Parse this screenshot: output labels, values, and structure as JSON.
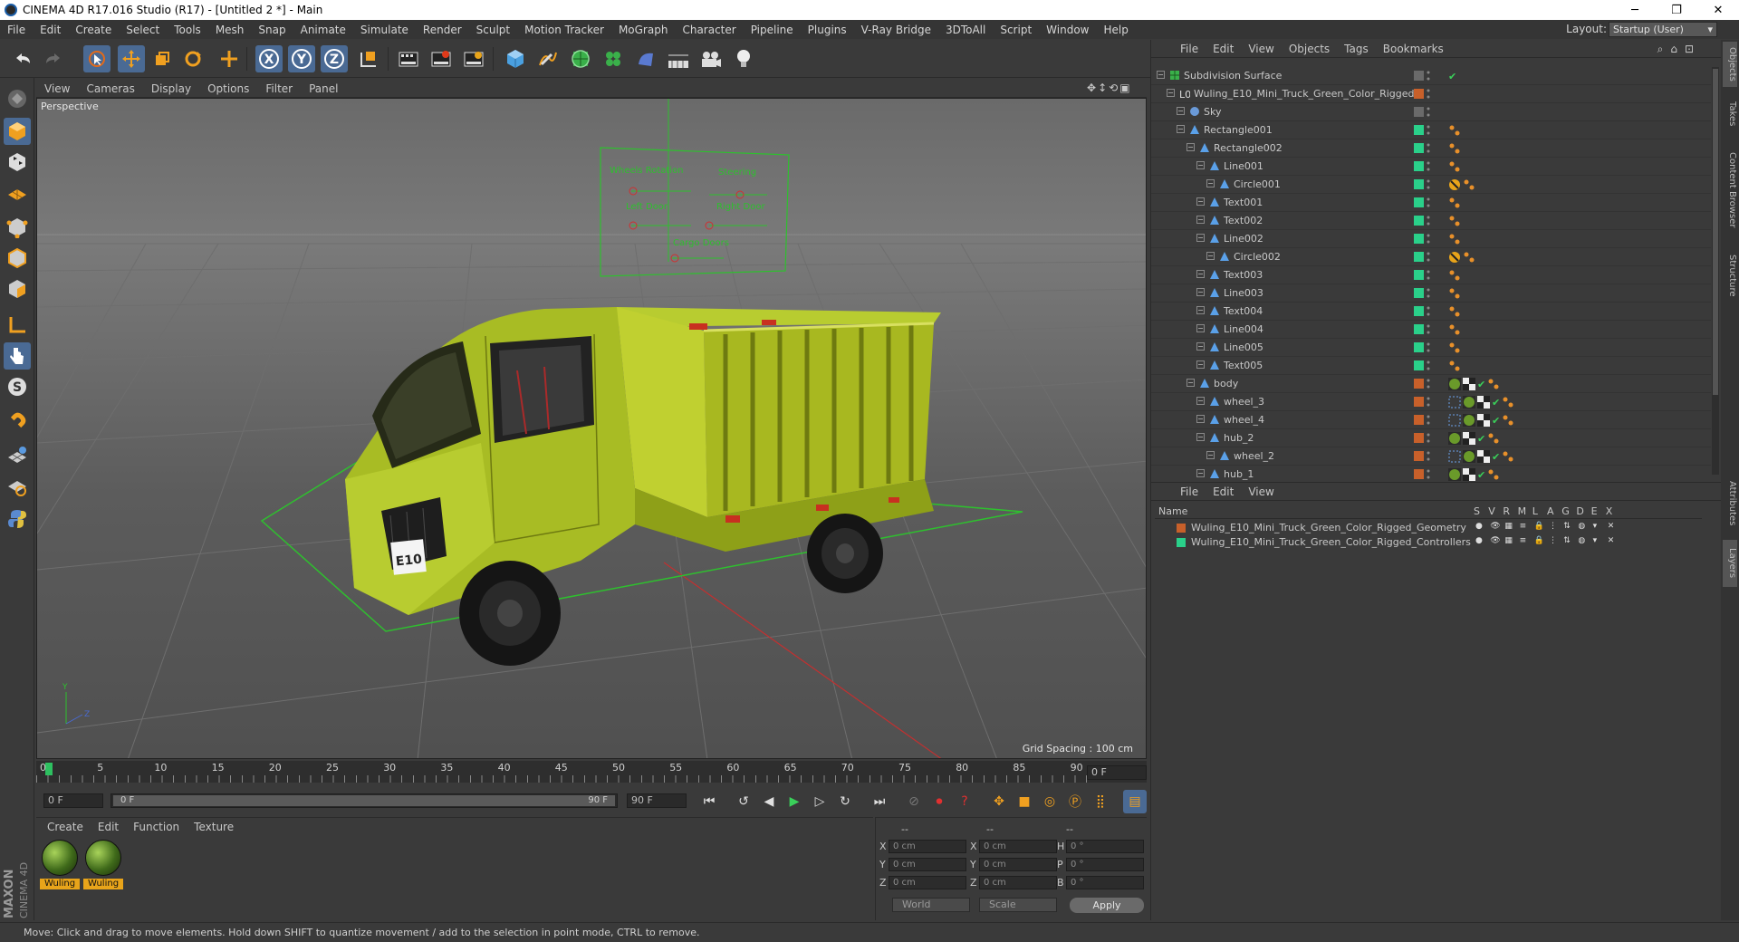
{
  "window": {
    "title": "CINEMA 4D R17.016 Studio (R17) - [Untitled 2 *] - Main",
    "minimize": "─",
    "maximize": "❐",
    "close": "✕"
  },
  "menubar": [
    "File",
    "Edit",
    "Create",
    "Select",
    "Tools",
    "Mesh",
    "Snap",
    "Animate",
    "Simulate",
    "Render",
    "Sculpt",
    "Motion Tracker",
    "MoGraph",
    "Character",
    "Pipeline",
    "Plugins",
    "V-Ray Bridge",
    "3DToAll",
    "Script",
    "Window",
    "Help"
  ],
  "layout": {
    "label": "Layout:",
    "value": "Startup (User)"
  },
  "toolbar": {
    "icons": [
      "undo-icon",
      "redo-icon",
      "select-arrow-icon",
      "move-icon",
      "scale-icon",
      "rotate-icon",
      "transform-icon",
      "x-axis-icon",
      "y-axis-icon",
      "z-axis-icon",
      "coordinate-system-icon",
      "render-view-icon",
      "render-picture-viewer-icon",
      "render-settings-icon",
      "cube-primitive-icon",
      "pen-spline-icon",
      "subdivision-icon",
      "cloner-icon",
      "deformer-icon",
      "floor-icon",
      "camera-icon",
      "light-icon"
    ],
    "x_label": "X",
    "y_label": "Y",
    "z_label": "Z"
  },
  "leftbar": {
    "icons": [
      "make-editable-icon",
      "model-mode-icon",
      "texture-mode-icon",
      "workplane-icon",
      "points-mode-icon",
      "edges-mode-icon",
      "polygons-mode-icon",
      "axis-mode-icon",
      "tweak-icon",
      "solo-icon",
      "magnet-icon",
      "snap-grid-icon",
      "snap-settings-icon",
      "python-icon"
    ]
  },
  "viewport": {
    "menu": [
      "View",
      "Cameras",
      "Display",
      "Options",
      "Filter",
      "Panel"
    ],
    "label": "Perspective",
    "grid_spacing": "Grid Spacing : 100 cm",
    "nav_icons": [
      "pan-icon",
      "zoom-icon",
      "orbit-icon",
      "maximize-icon"
    ],
    "controller_labels": [
      "Wheels Rotation",
      "Steering",
      "Left Door",
      "Right Door",
      "Cargo Doors"
    ],
    "plate_text": "E10",
    "axis_labels": [
      "Y",
      "Z"
    ]
  },
  "timeline": {
    "ticks": [
      "0",
      "5",
      "10",
      "15",
      "20",
      "25",
      "30",
      "35",
      "40",
      "45",
      "50",
      "55",
      "60",
      "65",
      "70",
      "75",
      "80",
      "85",
      "90"
    ],
    "current_frame": "0 F"
  },
  "transport": {
    "start_field": "0 F",
    "slider_left": "0 F",
    "slider_right": "90 F",
    "end_field": "90 F",
    "buttons": [
      "go-start-icon",
      "prev-key-icon",
      "prev-frame-icon",
      "play-icon",
      "next-frame-icon",
      "next-key-icon",
      "go-end-icon",
      "record-off-icon",
      "record-icon",
      "autokey-icon",
      "keyframe-sel-icon",
      "pos-key-icon",
      "scale-key-icon",
      "rot-key-icon",
      "param-key-icon",
      "pla-key-icon",
      "timeline-icon"
    ]
  },
  "material_panel": {
    "menu": [
      "Create",
      "Edit",
      "Function",
      "Texture"
    ],
    "materials": [
      {
        "name": "Wuling"
      },
      {
        "name": "Wuling"
      }
    ]
  },
  "coord_panel": {
    "headers": [
      "--",
      "--",
      "--"
    ],
    "rows": [
      {
        "l1": "X",
        "v1": "0 cm",
        "l2": "X",
        "v2": "0 cm",
        "l3": "H",
        "v3": "0 °"
      },
      {
        "l1": "Y",
        "v1": "0 cm",
        "l2": "Y",
        "v2": "0 cm",
        "l3": "P",
        "v3": "0 °"
      },
      {
        "l1": "Z",
        "v1": "0 cm",
        "l2": "Z",
        "v2": "0 cm",
        "l3": "B",
        "v3": "0 °"
      }
    ],
    "mode1": "World",
    "mode2": "Scale",
    "apply": "Apply"
  },
  "statusbar": {
    "text": "Move: Click and drag to move elements. Hold down SHIFT to quantize movement / add to the selection in point mode, CTRL to remove."
  },
  "branding": {
    "maxon": "MAXON",
    "c4d": "CINEMA 4D"
  },
  "object_manager": {
    "menu": [
      "File",
      "Edit",
      "View",
      "Objects",
      "Tags",
      "Bookmarks"
    ],
    "objects": [
      {
        "name": "Subdivision Surface",
        "depth": 0,
        "icon": "subdivision-icon",
        "color": "none",
        "tags": [
          "check"
        ]
      },
      {
        "name": "Wuling_E10_Mini_Truck_Green_Color_Rigged",
        "depth": 1,
        "icon": "null-icon",
        "color": "#c8602a",
        "tags": []
      },
      {
        "name": "Sky",
        "depth": 2,
        "icon": "sky-icon",
        "color": "none",
        "tags": []
      },
      {
        "name": "Rectangle001",
        "depth": 2,
        "icon": "spline-icon",
        "color": "#2ad08a",
        "tags": [
          "dot"
        ]
      },
      {
        "name": "Rectangle002",
        "depth": 3,
        "icon": "spline-icon",
        "color": "#2ad08a",
        "tags": [
          "dot"
        ]
      },
      {
        "name": "Line001",
        "depth": 4,
        "icon": "spline-icon",
        "color": "#2ad08a",
        "tags": [
          "dot"
        ]
      },
      {
        "name": "Circle001",
        "depth": 5,
        "icon": "spline-icon",
        "color": "#2ad08a",
        "tags": [
          "protect",
          "dot"
        ]
      },
      {
        "name": "Text001",
        "depth": 4,
        "icon": "spline-icon",
        "color": "#2ad08a",
        "tags": [
          "dot"
        ]
      },
      {
        "name": "Text002",
        "depth": 4,
        "icon": "spline-icon",
        "color": "#2ad08a",
        "tags": [
          "dot"
        ]
      },
      {
        "name": "Line002",
        "depth": 4,
        "icon": "spline-icon",
        "color": "#2ad08a",
        "tags": [
          "dot"
        ]
      },
      {
        "name": "Circle002",
        "depth": 5,
        "icon": "spline-icon",
        "color": "#2ad08a",
        "tags": [
          "protect",
          "dot"
        ]
      },
      {
        "name": "Text003",
        "depth": 4,
        "icon": "spline-icon",
        "color": "#2ad08a",
        "tags": [
          "dot"
        ]
      },
      {
        "name": "Line003",
        "depth": 4,
        "icon": "spline-icon",
        "color": "#2ad08a",
        "tags": [
          "dot"
        ]
      },
      {
        "name": "Text004",
        "depth": 4,
        "icon": "spline-icon",
        "color": "#2ad08a",
        "tags": [
          "dot"
        ]
      },
      {
        "name": "Line004",
        "depth": 4,
        "icon": "spline-icon",
        "color": "#2ad08a",
        "tags": [
          "dot"
        ]
      },
      {
        "name": "Line005",
        "depth": 4,
        "icon": "spline-icon",
        "color": "#2ad08a",
        "tags": [
          "dot"
        ]
      },
      {
        "name": "Text005",
        "depth": 4,
        "icon": "spline-icon",
        "color": "#2ad08a",
        "tags": [
          "dot"
        ]
      },
      {
        "name": "body",
        "depth": 3,
        "icon": "spline-icon",
        "color": "#c8602a",
        "tags": [
          "mat",
          "check",
          "dot"
        ]
      },
      {
        "name": "wheel_3",
        "depth": 4,
        "icon": "spline-icon",
        "color": "#c8602a",
        "tags": [
          "sel",
          "mat",
          "check",
          "dot"
        ]
      },
      {
        "name": "wheel_4",
        "depth": 4,
        "icon": "spline-icon",
        "color": "#c8602a",
        "tags": [
          "sel",
          "mat",
          "check",
          "dot"
        ]
      },
      {
        "name": "hub_2",
        "depth": 4,
        "icon": "spline-icon",
        "color": "#c8602a",
        "tags": [
          "mat",
          "check",
          "dot"
        ]
      },
      {
        "name": "wheel_2",
        "depth": 5,
        "icon": "spline-icon",
        "color": "#c8602a",
        "tags": [
          "sel",
          "mat",
          "check",
          "dot"
        ]
      },
      {
        "name": "hub_1",
        "depth": 4,
        "icon": "spline-icon",
        "color": "#c8602a",
        "tags": [
          "mat",
          "check",
          "dot"
        ]
      }
    ]
  },
  "layer_manager": {
    "menu": [
      "File",
      "Edit",
      "View"
    ],
    "columns": [
      "Name",
      "S",
      "V",
      "R",
      "M",
      "L",
      "A",
      "G",
      "D",
      "E",
      "X"
    ],
    "layers": [
      {
        "name": "Wuling_E10_Mini_Truck_Green_Color_Rigged_Geometry",
        "color": "#c8602a"
      },
      {
        "name": "Wuling_E10_Mini_Truck_Green_Color_Rigged_Controllers",
        "color": "#2ad08a"
      }
    ]
  },
  "right_tabs": [
    "Objects",
    "Takes",
    "Content Browser",
    "Structure",
    "Attributes",
    "Layers"
  ]
}
